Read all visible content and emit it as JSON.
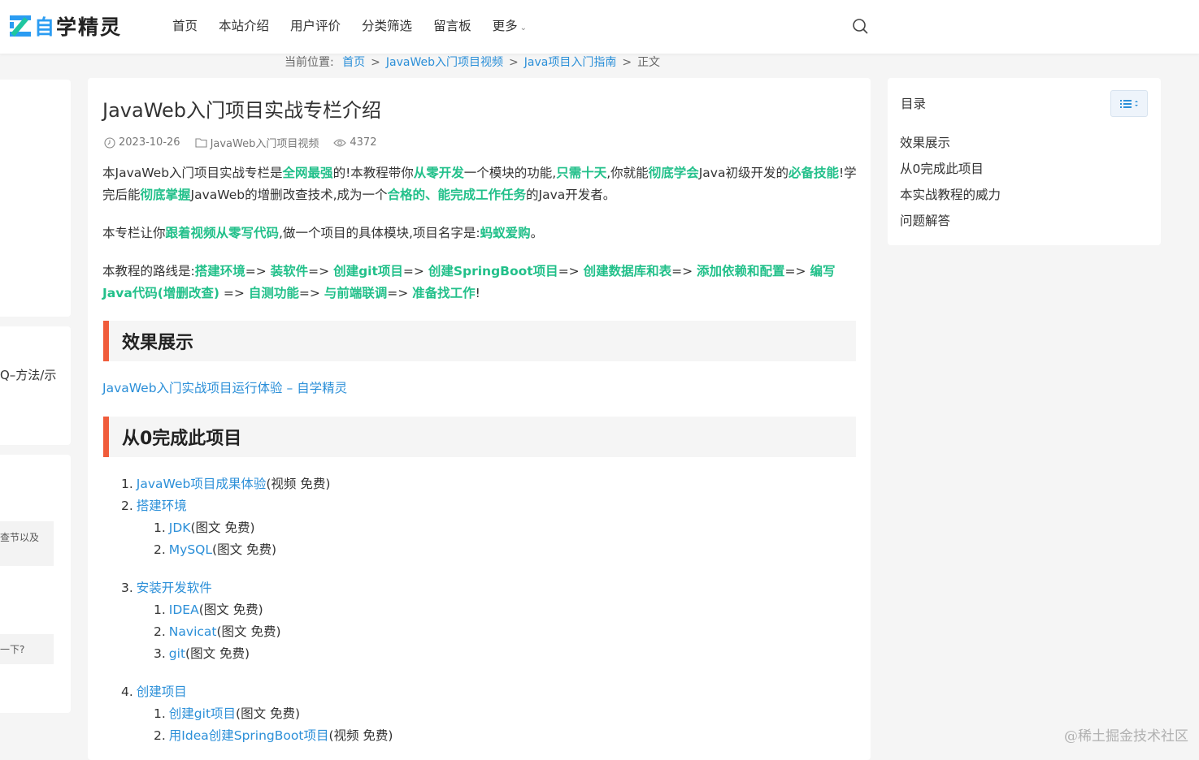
{
  "header": {
    "logo_text_1": "自",
    "logo_text_2": "学精灵",
    "nav": [
      "首页",
      "本站介绍",
      "用户评价",
      "分类筛选",
      "留言板",
      "更多"
    ]
  },
  "breadcrumb": {
    "label": "当前位置:",
    "items": [
      "首页",
      "JavaWeb入门项目视频",
      "Java项目入门指南"
    ],
    "current": "正文"
  },
  "sidebar_left": {
    "fragment_1": "Q–方法/示",
    "fragment_2": "查节以及",
    "fragment_3": "一下?"
  },
  "article": {
    "title": "JavaWeb入门项目实战专栏介绍",
    "date": "2023-10-26",
    "category": "JavaWeb入门项目视频",
    "views": "4372",
    "p1": [
      {
        "t": "本JavaWeb入门项目实战专栏是",
        "g": false
      },
      {
        "t": "全网最强",
        "g": true
      },
      {
        "t": "的!本教程带你",
        "g": false
      },
      {
        "t": "从零开发",
        "g": true
      },
      {
        "t": "一个模块的功能,",
        "g": false
      },
      {
        "t": "只需十天",
        "g": true
      },
      {
        "t": ",你就能",
        "g": false
      },
      {
        "t": "彻底学会",
        "g": true
      },
      {
        "t": "Java初级开发的",
        "g": false
      },
      {
        "t": "必备技能",
        "g": true
      },
      {
        "t": "!学完后能",
        "g": false
      },
      {
        "t": "彻底掌握",
        "g": true
      },
      {
        "t": "JavaWeb的增删改查技术,成为一个",
        "g": false
      },
      {
        "t": "合格的、能完成工作任务",
        "g": true
      },
      {
        "t": "的Java开发者。",
        "g": false
      }
    ],
    "p2": [
      {
        "t": "本专栏让你",
        "g": false
      },
      {
        "t": "跟着视频从零写代码",
        "g": true
      },
      {
        "t": ",做一个项目的具体模块,项目名字是:",
        "g": false
      },
      {
        "t": "蚂蚁爱购",
        "g": true
      },
      {
        "t": "。",
        "g": false
      }
    ],
    "p3": [
      {
        "t": "本教程的路线是:",
        "g": false
      },
      {
        "t": "搭建环境",
        "g": true
      },
      {
        "t": "=> ",
        "g": false
      },
      {
        "t": "装软件",
        "g": true
      },
      {
        "t": "=> ",
        "g": false
      },
      {
        "t": "创建git项目",
        "g": true
      },
      {
        "t": "=> ",
        "g": false
      },
      {
        "t": "创建SpringBoot项目",
        "g": true
      },
      {
        "t": "=> ",
        "g": false
      },
      {
        "t": "创建数据库和表",
        "g": true
      },
      {
        "t": "=> ",
        "g": false
      },
      {
        "t": "添加依赖和配置",
        "g": true
      },
      {
        "t": "=> ",
        "g": false
      },
      {
        "t": "编写Java代码(增删改查)",
        "g": true
      },
      {
        "t": " => ",
        "g": false
      },
      {
        "t": "自测功能",
        "g": true
      },
      {
        "t": "=> ",
        "g": false
      },
      {
        "t": "与前端联调",
        "g": true
      },
      {
        "t": "=> ",
        "g": false
      },
      {
        "t": "准备找工作",
        "g": true
      },
      {
        "t": "!",
        "g": false
      }
    ],
    "section1": "效果展示",
    "section1_link": "JavaWeb入门实战项目运行体验 – 自学精灵",
    "section2": "从0完成此项目",
    "list": [
      {
        "n": "1.",
        "link": "JavaWeb项目成果体验",
        "note": "(视频 免费)"
      },
      {
        "n": "2.",
        "link": "搭建环境",
        "note": ""
      },
      {
        "n": "1.",
        "link": "JDK",
        "note": "(图文 免费)"
      },
      {
        "n": "2.",
        "link": "MySQL",
        "note": "(图文 免费)"
      },
      {
        "n": "3.",
        "link": "安装开发软件",
        "note": ""
      },
      {
        "n": "1.",
        "link": "IDEA",
        "note": "(图文 免费)"
      },
      {
        "n": "2.",
        "link": "Navicat",
        "note": "(图文 免费)"
      },
      {
        "n": "3.",
        "link": "git",
        "note": "(图文 免费)"
      },
      {
        "n": "4.",
        "link": "创建项目",
        "note": ""
      },
      {
        "n": "1.",
        "link": "创建git项目",
        "note": "(图文 免费)"
      },
      {
        "n": "2.",
        "link": "用Idea创建SpringBoot项目",
        "note": "(视频 免费)"
      }
    ]
  },
  "toc": {
    "title": "目录",
    "items": [
      "效果展示",
      "从0完成此项目",
      "本实战教程的威力",
      "问题解答"
    ]
  },
  "watermark": "@稀土掘金技术社区",
  "colors": {
    "accent_green": "#22c08a",
    "link_blue": "#2b8fd8",
    "section_bar": "#f05c3b"
  }
}
